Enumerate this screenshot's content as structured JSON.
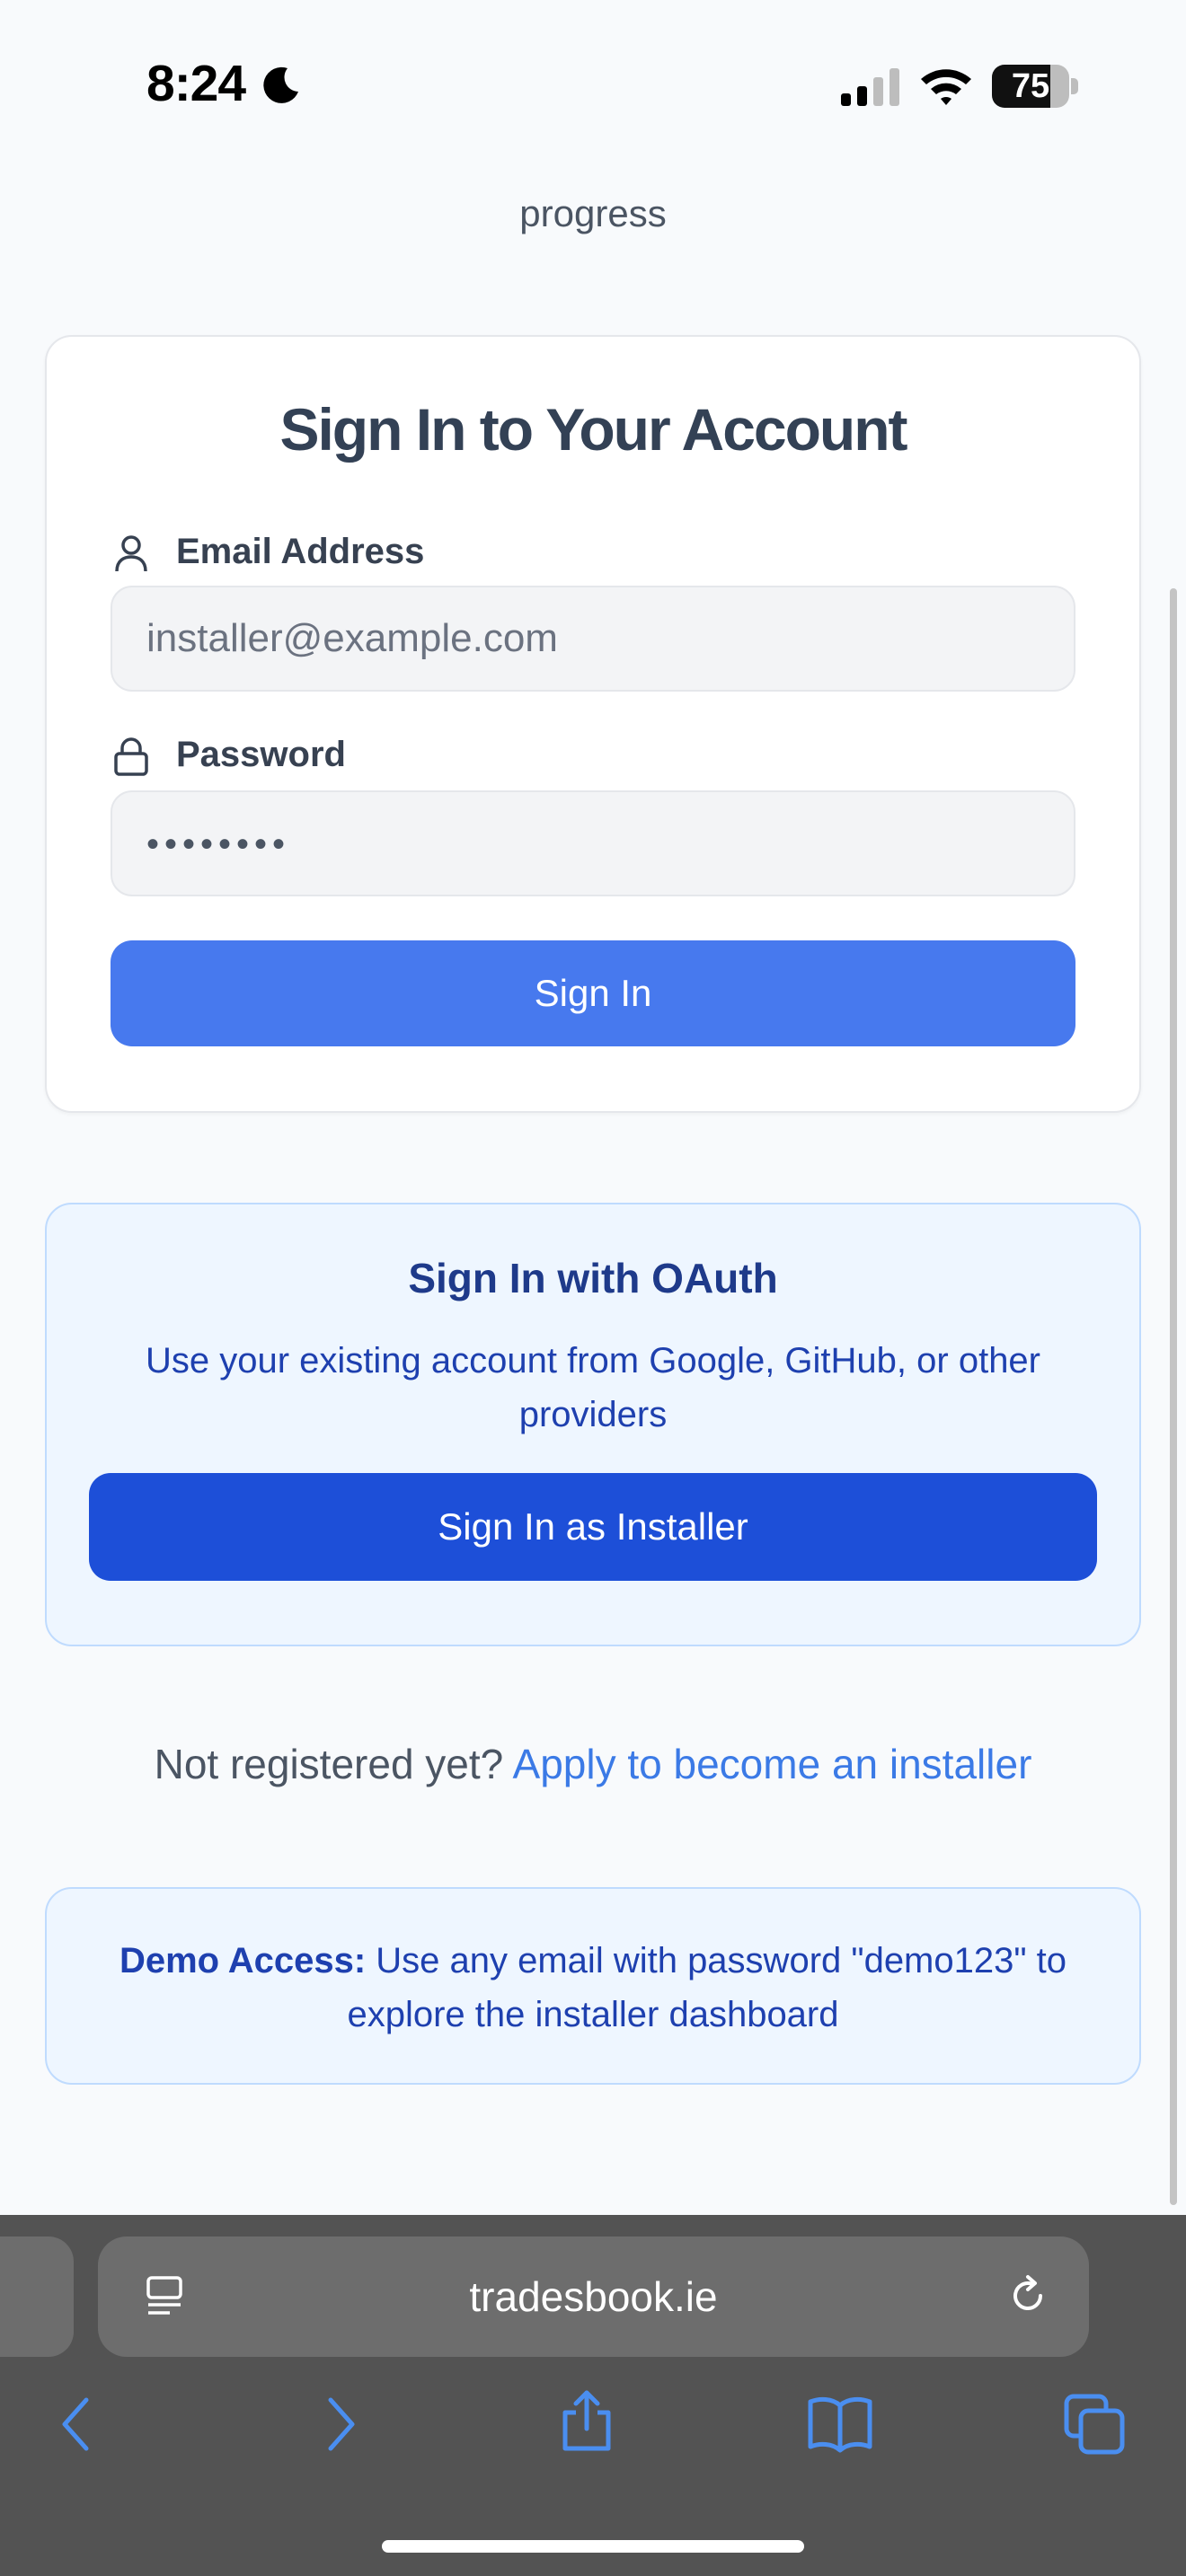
{
  "status_bar": {
    "time": "8:24",
    "battery": "75",
    "battery_percent": 75
  },
  "header": {
    "subtitle_end": "progress"
  },
  "signin_card": {
    "title": "Sign In to Your Account",
    "email_label": "Email Address",
    "email_placeholder": "installer@example.com",
    "password_label": "Password",
    "password_value": "••••••••",
    "submit_label": "Sign In"
  },
  "oauth": {
    "title": "Sign In with OAuth",
    "description": "Use your existing account from Google, GitHub, or other providers",
    "button_label": "Sign In as Installer"
  },
  "register": {
    "prompt": "Not registered yet?",
    "link_label": "Apply to become an installer"
  },
  "demo": {
    "label": "Demo Access:",
    "text": "Use any email with password \"demo123\" to explore the installer dashboard"
  },
  "browser": {
    "url": "tradesbook.ie"
  },
  "icons": {
    "moon": "moon-icon",
    "signal": "cellular-signal-icon",
    "wifi": "wifi-icon",
    "battery": "battery-icon",
    "user": "user-icon",
    "lock": "lock-icon",
    "reader": "reader-mode-icon",
    "reload": "reload-icon",
    "back": "back-icon",
    "forward": "forward-icon",
    "share": "share-icon",
    "bookmarks": "bookmarks-icon",
    "tabs": "tabs-icon"
  },
  "colors": {
    "primary": "#4779ee",
    "oauth_button": "#1d4fd8",
    "link": "#3b7ae6",
    "safari_accent": "#4a8ef0"
  }
}
